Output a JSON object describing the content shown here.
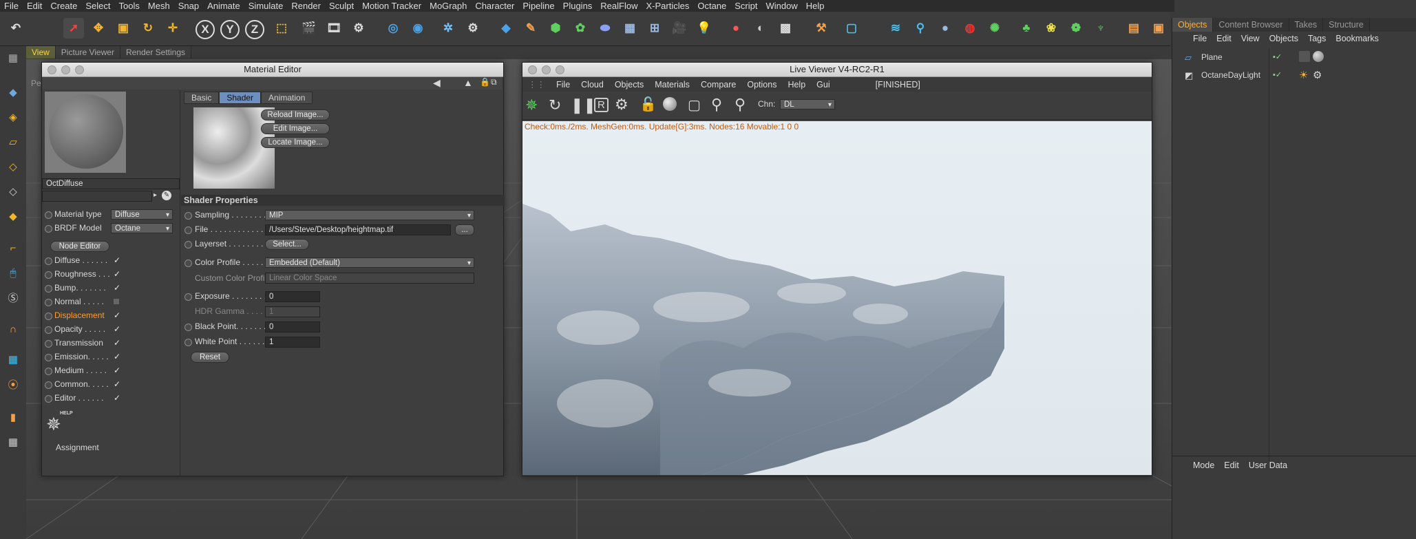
{
  "menubar": [
    "File",
    "Edit",
    "Create",
    "Select",
    "Tools",
    "Mesh",
    "Snap",
    "Animate",
    "Simulate",
    "Render",
    "Sculpt",
    "Motion Tracker",
    "MoGraph",
    "Character",
    "Pipeline",
    "Plugins",
    "RealFlow",
    "X-Particles",
    "Octane",
    "Script",
    "Window",
    "Help"
  ],
  "view_tabs": [
    "View",
    "Picture Viewer",
    "Render Settings"
  ],
  "material_editor": {
    "title": "Material Editor",
    "material_name": "OctDiffuse",
    "side_label": "Pe",
    "material_type_label": "Material type",
    "material_type_value": "Diffuse",
    "brdf_label": "BRDF Model",
    "brdf_value": "Octane",
    "node_editor": "Node Editor",
    "channels": [
      {
        "label": "Diffuse . . . . . .",
        "checked": "✓"
      },
      {
        "label": "Roughness . . .",
        "checked": "✓"
      },
      {
        "label": "Bump. . . . . . .",
        "checked": "✓"
      },
      {
        "label": "Normal . . . . .",
        "checked": ""
      },
      {
        "label": "Displacement",
        "checked": "✓"
      },
      {
        "label": "Opacity . . . . .",
        "checked": "✓"
      },
      {
        "label": "Transmission",
        "checked": "✓"
      },
      {
        "label": "Emission. . . . .",
        "checked": "✓"
      },
      {
        "label": "Medium . . . . .",
        "checked": "✓"
      },
      {
        "label": "Common. . . . .",
        "checked": "✓"
      },
      {
        "label": "Editor . . . . . .",
        "checked": "✓"
      }
    ],
    "help": "HELP",
    "assignment": "Assignment",
    "tabs": [
      "Basic",
      "Shader",
      "Animation"
    ],
    "reload": "Reload Image...",
    "edit": "Edit Image...",
    "locate": "Locate Image...",
    "section": "Shader Properties",
    "props": {
      "sampling_label": "Sampling . . . . . . . . . . . .",
      "sampling_value": "MIP",
      "file_label": "File . . . . . . . . . . . . . . . . .",
      "file_value": "/Users/Steve/Desktop/heightmap.tif",
      "file_btn": "...",
      "layerset_label": "Layerset . . . . . . . . . . . . .",
      "layerset_btn": "Select...",
      "color_profile_label": "Color Profile . . . . . . . . .",
      "color_profile_value": "Embedded (Default)",
      "custom_profile_label": "Custom Color Profile",
      "custom_profile_value": "Linear Color Space",
      "exposure_label": "Exposure . . . . . . . . . . . . .",
      "exposure_value": "0",
      "hdr_label": "HDR Gamma . . . . . . . . . .",
      "hdr_value": "1",
      "black_label": "Black Point. . . . . . . . . . .",
      "black_value": "0",
      "white_label": "White Point . . . . . . . . . .",
      "white_value": "1",
      "reset": "Reset"
    }
  },
  "live_viewer": {
    "title": "Live Viewer V4-RC2-R1",
    "menu": [
      "File",
      "Cloud",
      "Objects",
      "Materials",
      "Compare",
      "Options",
      "Help",
      "Gui"
    ],
    "status": "[FINISHED]",
    "chn_label": "Chn:",
    "chn_value": "DL",
    "stats": "Check:0ms./2ms. MeshGen:0ms. Update[G]:3ms. Nodes:16 Movable:1  0 0"
  },
  "objects_panel": {
    "tabs": [
      "Objects",
      "Content Browser",
      "Takes",
      "Structure"
    ],
    "menu": [
      "File",
      "Edit",
      "View",
      "Objects",
      "Tags",
      "Bookmarks"
    ],
    "items": [
      "Plane",
      "OctaneDayLight"
    ],
    "attr_menu": [
      "Mode",
      "Edit",
      "User Data"
    ]
  },
  "colors": {
    "accent": "#ffb030",
    "active_tab": "#6c8fbf",
    "displacement": "#ff9c2a"
  }
}
